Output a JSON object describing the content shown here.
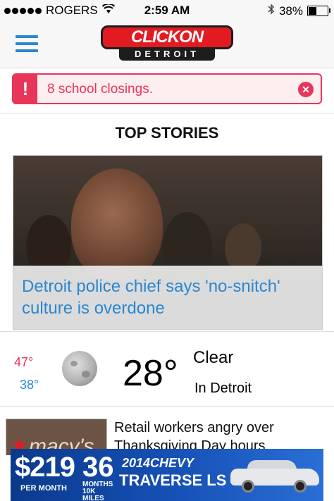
{
  "status_bar": {
    "carrier": "ROGERS",
    "time": "2:59 AM",
    "battery": "38%",
    "battery_level": 0.38
  },
  "header": {
    "logo_top": "CLICKON",
    "logo_bottom": "DETROIT"
  },
  "alert": {
    "icon_text": "!",
    "text": "8 school closings."
  },
  "section": {
    "title": "TOP STORIES"
  },
  "hero_story": {
    "headline": "Detroit police chief says 'no-snitch' culture is overdone"
  },
  "weather": {
    "high": "47°",
    "low": "38°",
    "current_temp": "28°",
    "condition": "Clear",
    "location": "In Detroit"
  },
  "stories": [
    {
      "thumb_label": "macy's",
      "title": "Retail workers angry over Thanksgiving Day hours"
    }
  ],
  "ad": {
    "price": "$219",
    "price_sub": "PER MONTH",
    "months": "36",
    "months_sub": "MONTHS 10K MILES",
    "year_make": "2014CHEVY",
    "model": "TRAVERSE LS"
  },
  "colors": {
    "accent_blue": "#2a87d0",
    "alert_red": "#e8355a",
    "logo_red": "#e21b23"
  }
}
